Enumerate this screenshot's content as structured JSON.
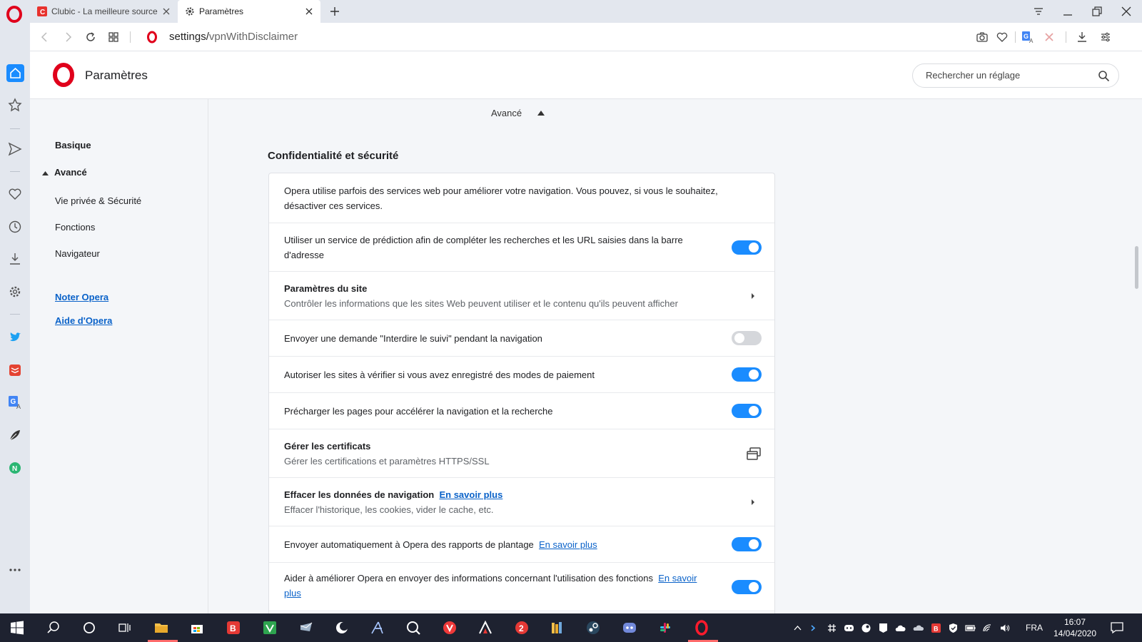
{
  "tabs": [
    {
      "title": "Clubic - La meilleure source",
      "active": false
    },
    {
      "title": "Paramètres",
      "active": true
    }
  ],
  "address": {
    "prefix": "settings/",
    "path": "vpnWithDisclaimer"
  },
  "header": {
    "title": "Paramètres",
    "search_placeholder": "Rechercher un réglage"
  },
  "nav": {
    "basique": "Basique",
    "avance": "Avancé",
    "items": [
      "Vie privée & Sécurité",
      "Fonctions",
      "Navigateur"
    ],
    "links": [
      "Noter Opera",
      "Aide d'Opera"
    ]
  },
  "content": {
    "avance_label": "Avancé",
    "section_title": "Confidentialité et sécurité",
    "rows": [
      {
        "text": "Opera utilise parfois des services web pour améliorer votre navigation. Vous pouvez, si vous le souhaitez, désactiver ces services."
      },
      {
        "text": "Utiliser un service de prédiction afin de compléter les recherches et les URL saisies dans la barre d'adresse",
        "toggle": true
      },
      {
        "title": "Paramètres du site",
        "sub": "Contrôler les informations que les sites Web peuvent utiliser et le contenu qu'ils peuvent afficher"
      },
      {
        "text": "Envoyer une demande \"Interdire le suivi\" pendant la navigation",
        "toggle": false
      },
      {
        "text": "Autoriser les sites à vérifier si vous avez enregistré des modes de paiement",
        "toggle": true
      },
      {
        "text": "Précharger les pages pour accélérer la navigation et la recherche",
        "toggle": true
      },
      {
        "title": "Gérer les certificats",
        "sub": "Gérer les certifications et paramètres HTTPS/SSL"
      },
      {
        "title": "Effacer les données de navigation",
        "link": "En savoir plus",
        "sub": "Effacer l'historique, les cookies, vider le cache, etc."
      },
      {
        "text": "Envoyer automatiquement à Opera des rapports de plantage",
        "link": "En savoir plus",
        "toggle": true
      },
      {
        "text": "Aider à améliorer Opera en envoyer des informations concernant l'utilisation des fonctions",
        "link": "En savoir plus",
        "toggle": true
      }
    ]
  },
  "taskbar": {
    "lang": "FRA",
    "time": "16:07",
    "date": "14/04/2020"
  },
  "colors": {
    "accent": "#1a8cff",
    "opera_red": "#e0001b",
    "link": "#0a62c9",
    "taskbar": "#1e2230"
  }
}
